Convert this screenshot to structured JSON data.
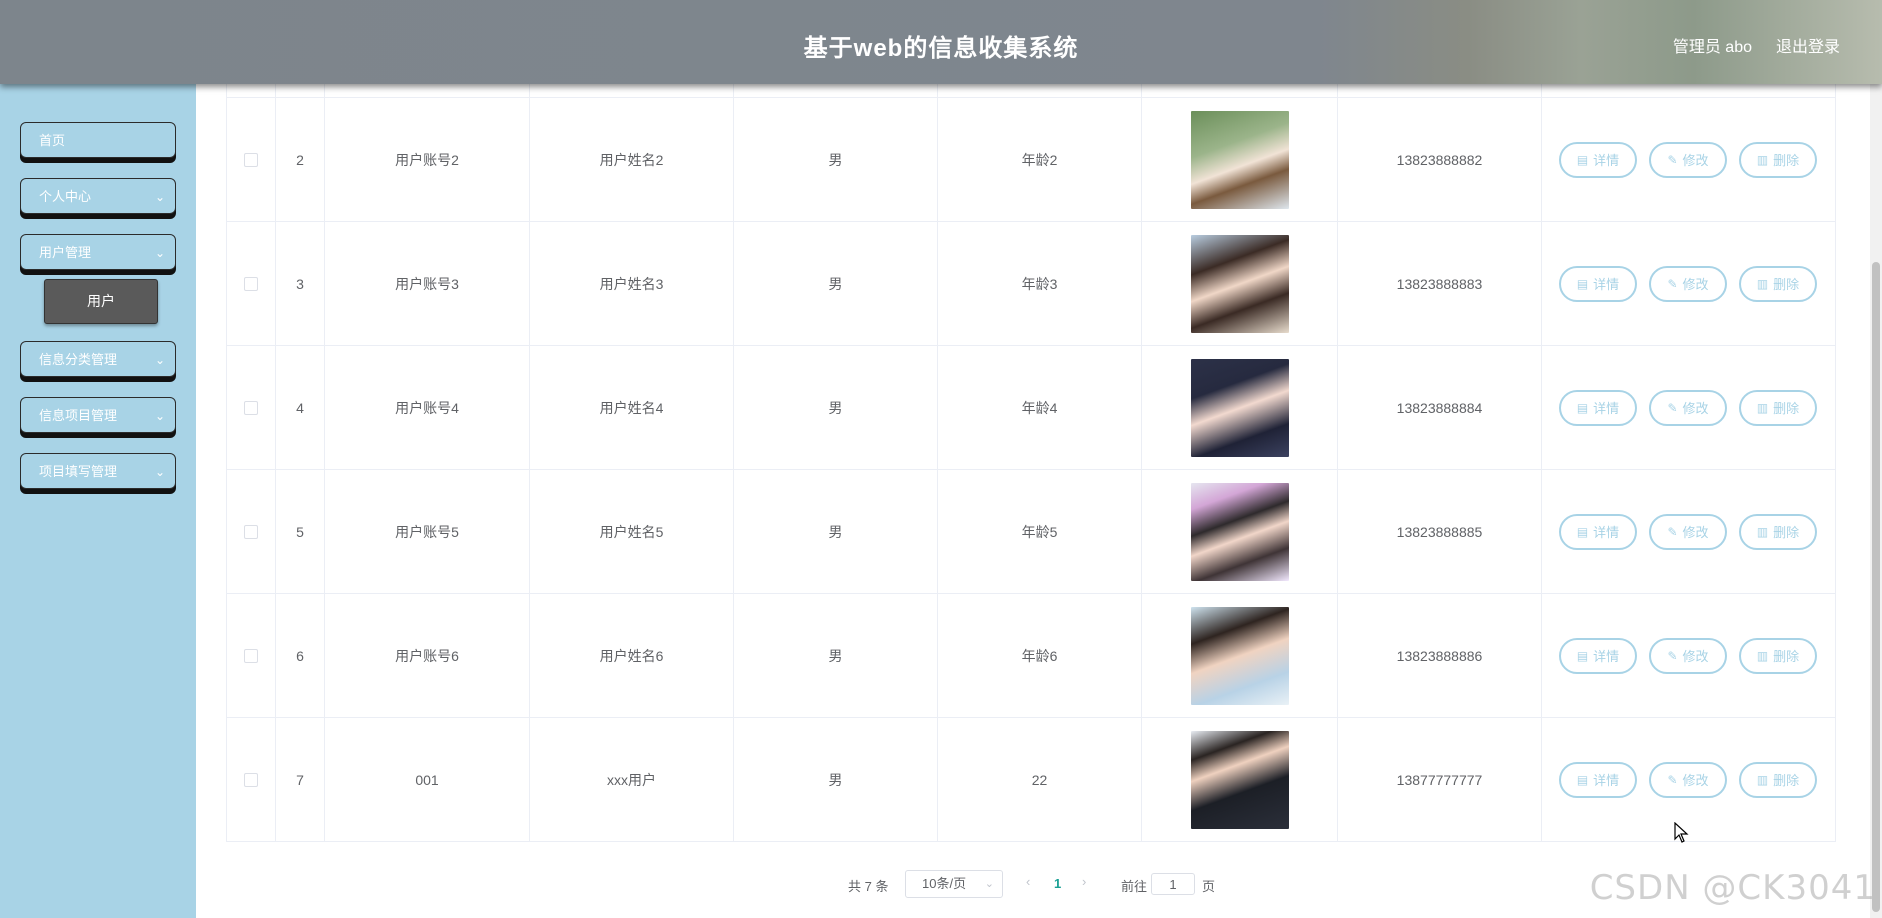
{
  "header": {
    "title": "基于web的信息收集系统",
    "user": "管理员 abo",
    "logout": "退出登录"
  },
  "sidebar": {
    "items": [
      {
        "label": "首页",
        "has_chevron": false
      },
      {
        "label": "个人中心",
        "has_chevron": true
      },
      {
        "label": "用户管理",
        "has_chevron": true
      },
      {
        "label": "信息分类管理",
        "has_chevron": true
      },
      {
        "label": "信息项目管理",
        "has_chevron": true
      },
      {
        "label": "项目填写管理",
        "has_chevron": true
      }
    ],
    "submenu_label": "用户",
    "chevron": "chevron-down-icon"
  },
  "table": {
    "rows": [
      {
        "index": "2",
        "account": "用户账号2",
        "name": "用户姓名2",
        "sex": "男",
        "age": "年龄2",
        "phone": "13823888882"
      },
      {
        "index": "3",
        "account": "用户账号3",
        "name": "用户姓名3",
        "sex": "男",
        "age": "年龄3",
        "phone": "13823888883"
      },
      {
        "index": "4",
        "account": "用户账号4",
        "name": "用户姓名4",
        "sex": "男",
        "age": "年龄4",
        "phone": "13823888884"
      },
      {
        "index": "5",
        "account": "用户账号5",
        "name": "用户姓名5",
        "sex": "男",
        "age": "年龄5",
        "phone": "13823888885"
      },
      {
        "index": "6",
        "account": "用户账号6",
        "name": "用户姓名6",
        "sex": "男",
        "age": "年龄6",
        "phone": "13823888886"
      },
      {
        "index": "7",
        "account": "001",
        "name": "xxx用户",
        "sex": "男",
        "age": "22",
        "phone": "13877777777"
      }
    ],
    "actions": {
      "detail": "详情",
      "edit": "修改",
      "delete": "删除"
    }
  },
  "pagination": {
    "total": "共 7 条",
    "page_size": "10条/页",
    "current_page": "1",
    "goto_label": "前往",
    "goto_value": "1",
    "page_label": "页"
  },
  "watermark": "CSDN @CK3041",
  "colors": {
    "sidebar_bg": "#a8d3e6",
    "accent": "#a8d3e6",
    "active_page": "#1aa094"
  }
}
